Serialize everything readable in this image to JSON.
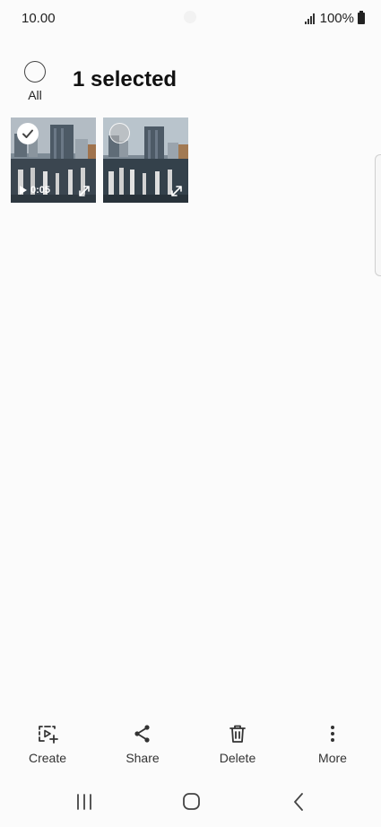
{
  "status": {
    "time": "10.00",
    "battery": "100%"
  },
  "header": {
    "all_label": "All",
    "title": "1 selected"
  },
  "gallery": {
    "items": [
      {
        "type": "video",
        "duration": "0:05",
        "selected": true
      },
      {
        "type": "image",
        "selected": false
      }
    ]
  },
  "toolbar": {
    "create": "Create",
    "share": "Share",
    "delete": "Delete",
    "more": "More"
  },
  "colors": {
    "background": "#fbfbfb",
    "text": "#111111",
    "icon": "#333333"
  },
  "nav": {
    "recents_icon": "recents-icon",
    "home_icon": "home-icon",
    "back_icon": "back-icon"
  }
}
